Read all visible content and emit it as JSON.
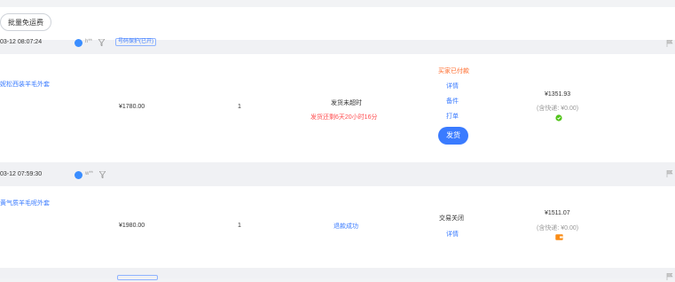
{
  "toolbar": {
    "batch_free_shipping": "批量免运费"
  },
  "orders": [
    {
      "time": "03-12 08:07:24",
      "buyer": "h**",
      "tag": "号码保护(已开)",
      "product": "妮松西装羊毛外套",
      "price": "¥1780.00",
      "qty": "1",
      "status": "发货未超时",
      "countdown": "发货还剩6天20小时16分",
      "buyer_state": "买家已付款",
      "actions": [
        "详情",
        "备件",
        "打单"
      ],
      "ship_button": "发货",
      "total": "¥1351.93",
      "shipping_note": "(含快递: ¥0.00)",
      "badge_color": "#52c41a"
    },
    {
      "time": "03-12 07:59:30",
      "buyer": "w**",
      "product": "黄气质羊毛呢外套",
      "price": "¥1980.00",
      "qty": "1",
      "refund": "退款成功",
      "close_status": "交易关闭",
      "detail": "详情",
      "total": "¥1511.07",
      "shipping_note": "(含快递: ¥0.00)",
      "badge_color": "#fa8c16"
    }
  ]
}
